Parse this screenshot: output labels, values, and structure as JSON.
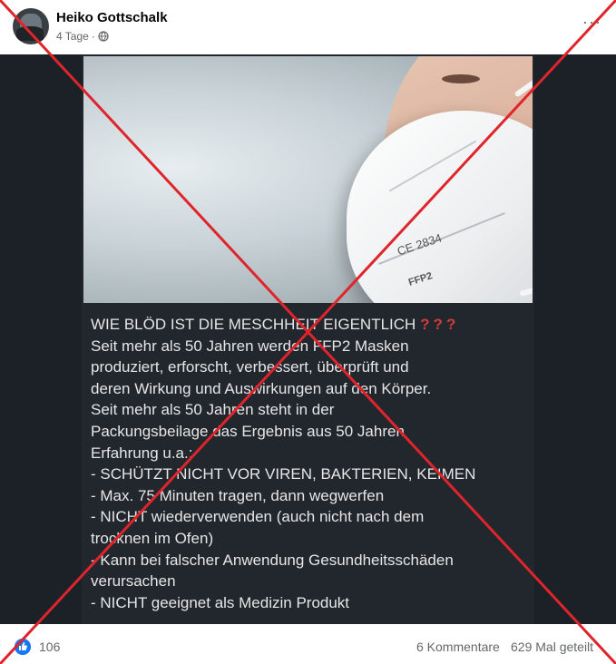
{
  "post": {
    "author": "Heiko Gottschalk",
    "time": "4 Tage",
    "visibility_icon": "globe-icon",
    "more_icon": "ellipsis-icon",
    "more_glyph": "···"
  },
  "image_text": {
    "heading": "WIE BLÖD IST DIE MESCHHEIT EIGENTLICH",
    "heading_marks": "???",
    "lines": [
      "Seit mehr als 50 Jahren werden FFP2 Masken",
      "produziert, erforscht, verbessert, überprüft und",
      "deren Wirkung und Auswirkungen auf den Körper.",
      "Seit mehr als 50 Jahren steht in der",
      "Packungsbeilage das Ergebnis aus 50 Jahren",
      "Erfahrung u.a.:",
      "- SCHÜTZT NICHT VOR VIREN, BAKTERIEN, KEIMEN",
      "- Max. 75 Minuten tragen, dann wegwerfen",
      "- NICHT wiederverwenden (auch nicht nach dem",
      "trocknen im Ofen)",
      "- Kann bei falscher Anwendung Gesundheitsschäden",
      "verursachen",
      "- NICHT geeignet als Medizin Produkt"
    ],
    "mask_print": "CE 2834",
    "mask_print2": "FFP2"
  },
  "footer": {
    "reactions_count": "106",
    "reaction_icon": "like-icon",
    "comments": "6 Kommentare",
    "shares": "629 Mal geteilt"
  },
  "overlay": {
    "type": "red-cross",
    "color": "#e0242b"
  }
}
